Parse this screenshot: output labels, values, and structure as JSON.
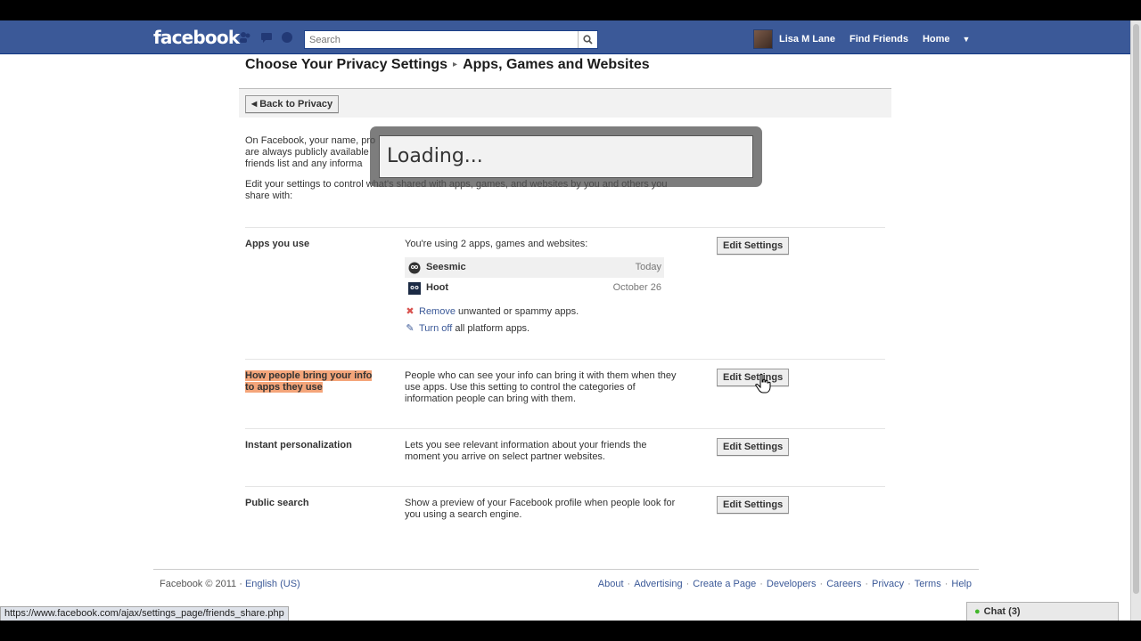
{
  "header": {
    "logo": "facebook",
    "search_placeholder": "Search",
    "user_name": "Lisa M Lane",
    "find_friends": "Find Friends",
    "home": "Home"
  },
  "breadcrumb": {
    "root": "Choose Your Privacy Settings",
    "separator": "▸",
    "current": "Apps, Games and Websites"
  },
  "back_button": "Back to Privacy",
  "intro": {
    "para1_line1": "On Facebook, your name, pro",
    "para1_line2": "are always publicly available",
    "para1_line3": "friends list and any informa",
    "para2": "Edit your settings to control what's shared with apps, games, and websites by you and others you share with:"
  },
  "loading_text": "Loading...",
  "sections": [
    {
      "label": "Apps you use",
      "description": "You're using 2 apps, games and websites:",
      "button": "Edit Settings",
      "apps": [
        {
          "name": "Seesmic",
          "date": "Today"
        },
        {
          "name": "Hoot",
          "date": "October 26"
        }
      ],
      "remove_link": "Remove",
      "remove_rest": " unwanted or spammy apps.",
      "turnoff_link": "Turn off",
      "turnoff_rest": " all platform apps."
    },
    {
      "label": "How people bring your info to apps they use",
      "description": "People who can see your info can bring it with them when they use apps. Use this setting to control the categories of information people can bring with them.",
      "button": "Edit Settings"
    },
    {
      "label": "Instant personalization",
      "description": "Lets you see relevant information about your friends the moment you arrive on select partner websites.",
      "button": "Edit Settings"
    },
    {
      "label": "Public search",
      "description": "Show a preview of your Facebook profile when people look for you using a search engine.",
      "button": "Edit Settings"
    }
  ],
  "footer": {
    "copyright": "Facebook © 2011 ·",
    "language": "English (US)",
    "links": [
      "About",
      "Advertising",
      "Create a Page",
      "Developers",
      "Careers",
      "Privacy",
      "Terms",
      "Help"
    ]
  },
  "status_url": "https://www.facebook.com/ajax/settings_page/friends_share.php",
  "chat": "Chat (3)",
  "colors": {
    "header_blue": "#3b5998",
    "link_blue": "#3b5998",
    "highlight": "#f4a57a"
  }
}
